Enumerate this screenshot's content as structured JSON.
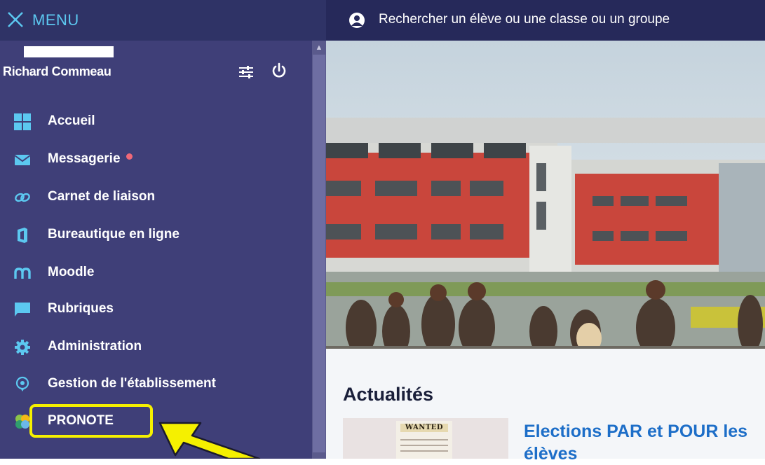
{
  "menu": {
    "label": "MENU"
  },
  "user": {
    "name": "Richard Commeau"
  },
  "nav": {
    "items": [
      {
        "label": "Accueil",
        "icon": "grid-icon"
      },
      {
        "label": "Messagerie",
        "icon": "envelope-icon"
      },
      {
        "label": "Carnet de liaison",
        "icon": "link-icon"
      },
      {
        "label": "Bureautique en ligne",
        "icon": "office-icon"
      },
      {
        "label": "Moodle",
        "icon": "moodle-icon"
      },
      {
        "label": "Rubriques",
        "icon": "chat-bubble-icon"
      },
      {
        "label": "Administration",
        "icon": "gear-icon"
      },
      {
        "label": "Gestion de l'établissement",
        "icon": "location-pin-icon"
      },
      {
        "label": "PRONOTE",
        "icon": "pronote-logo-icon"
      }
    ]
  },
  "search": {
    "placeholder": "Rechercher un élève ou une classe ou un groupe"
  },
  "news": {
    "title": "Actualités",
    "item_title": "Elections PAR et POUR les élèves",
    "thumbnail_label": "WANTED"
  },
  "colors": {
    "sidebar": "#3f3f78",
    "topbar": "#26295a",
    "accent": "#5cc8f0",
    "highlight": "#f5f000",
    "link": "#1d6ec8",
    "notification": "#f06878"
  }
}
